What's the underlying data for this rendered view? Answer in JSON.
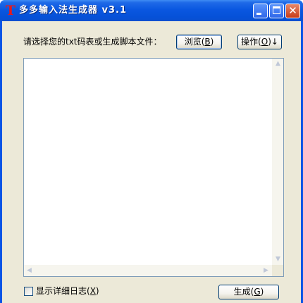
{
  "window": {
    "title": "多多输入法生成器 v3.1",
    "app_icon": "T",
    "colors": {
      "titlebar": "#0a55e6",
      "client": "#ece9d8",
      "close_button": "#d24a24"
    }
  },
  "main": {
    "prompt": "请选择您的txt码表或生成脚本文件：",
    "browse_button": {
      "prefix": "浏览(",
      "key": "B",
      "suffix": ")"
    },
    "action_button": {
      "prefix": "操作(",
      "key": "O",
      "suffix": ")↓"
    },
    "text_area_value": ""
  },
  "footer": {
    "checkbox": {
      "prefix": "显示详细日志(",
      "key": "X",
      "suffix": ")",
      "checked": false
    },
    "generate_button": {
      "prefix": "生成(",
      "key": "G",
      "suffix": ")"
    }
  },
  "icons": [
    "app-icon",
    "minimize-icon",
    "maximize-icon",
    "close-icon",
    "scroll-up-arrow-icon",
    "scroll-down-arrow-icon",
    "scroll-left-arrow-icon",
    "scroll-right-arrow-icon"
  ]
}
